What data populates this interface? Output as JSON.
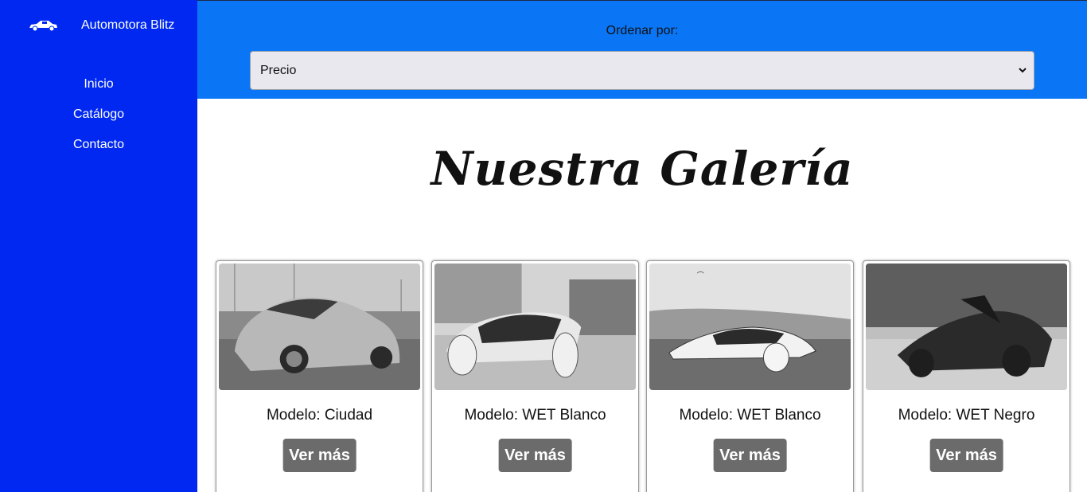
{
  "brand": {
    "name": "Automotora Blitz",
    "icon": "car-icon"
  },
  "nav": {
    "items": [
      {
        "label": "Inicio"
      },
      {
        "label": "Catálogo"
      },
      {
        "label": "Contacto"
      }
    ]
  },
  "sort": {
    "label": "Ordenar por:",
    "selected": "Precio"
  },
  "gallery": {
    "title": "Nuestra Galería",
    "cards": [
      {
        "model": "Modelo: Ciudad",
        "button": "Ver más"
      },
      {
        "model": "Modelo: WET Blanco",
        "button": "Ver más"
      },
      {
        "model": "Modelo: WET Blanco",
        "button": "Ver más"
      },
      {
        "model": "Modelo: WET Negro",
        "button": "Ver más"
      }
    ]
  },
  "colors": {
    "sidebar": "#0028f0",
    "topbar": "#0a76f6",
    "button": "#6b6b6b"
  }
}
